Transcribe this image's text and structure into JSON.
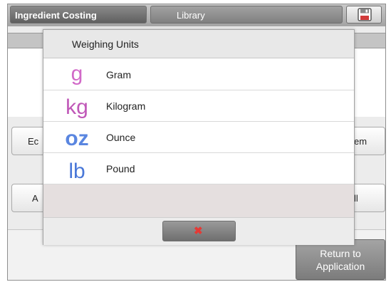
{
  "tabs": {
    "active_label": "Ingredient Costing",
    "library_label": "Library",
    "save_icon": "save-icon"
  },
  "background": {
    "left_button_1_fragment": "Ec",
    "right_button_1_fragment": "em",
    "left_button_2_fragment": "A",
    "right_button_2_fragment": "ll",
    "return_line1": "Return to",
    "return_line2": "Application"
  },
  "dialog": {
    "title": "Weighing Units",
    "units": [
      {
        "symbol": "g",
        "label": "Gram",
        "color": "#d169c8"
      },
      {
        "symbol": "kg",
        "label": "Kilogram",
        "color": "#c058b8"
      },
      {
        "symbol": "oz",
        "label": "Ounce",
        "color": "#5a86e0"
      },
      {
        "symbol": "lb",
        "label": "Pound",
        "color": "#4a78d8"
      }
    ],
    "close_icon": "close-x-icon"
  }
}
